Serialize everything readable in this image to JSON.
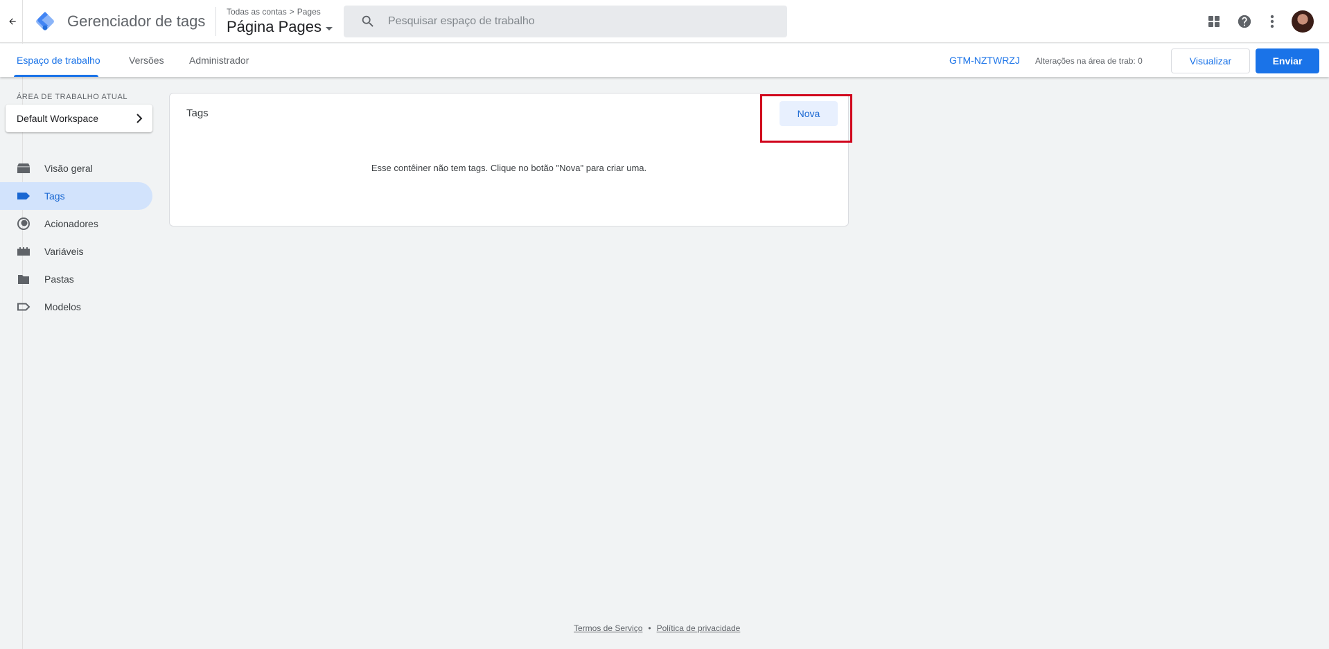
{
  "header": {
    "app_title": "Gerenciador de tags",
    "breadcrumb_account": "Todas as contas",
    "breadcrumb_separator": ">",
    "breadcrumb_container": "Pages",
    "container_name": "Página Pages",
    "search_placeholder": "Pesquisar espaço de trabalho",
    "search_value": "",
    "icons": [
      "back-arrow-icon",
      "gtm-logo",
      "search-icon",
      "apps-grid-icon",
      "help-icon",
      "more-vert-icon",
      "avatar"
    ]
  },
  "nav": {
    "tabs": [
      {
        "label": "Espaço de trabalho",
        "active": true
      },
      {
        "label": "Versões",
        "active": false
      },
      {
        "label": "Administrador",
        "active": false
      }
    ],
    "container_id": "GTM-NZTWRZJ",
    "changes_label": "Alterações na área de trab: 0",
    "preview_label": "Visualizar",
    "submit_label": "Enviar"
  },
  "sidebar": {
    "workspace_caption": "ÁREA DE TRABALHO ATUAL",
    "workspace_name": "Default Workspace",
    "items": [
      {
        "label": "Visão geral",
        "icon": "overview-icon",
        "active": false
      },
      {
        "label": "Tags",
        "icon": "tag-icon",
        "active": true
      },
      {
        "label": "Acionadores",
        "icon": "trigger-icon",
        "active": false
      },
      {
        "label": "Variáveis",
        "icon": "variable-icon",
        "active": false
      },
      {
        "label": "Pastas",
        "icon": "folder-icon",
        "active": false
      },
      {
        "label": "Modelos",
        "icon": "template-icon",
        "active": false
      }
    ]
  },
  "main": {
    "card_title": "Tags",
    "new_button_label": "Nova",
    "empty_message": "Esse contêiner não tem tags. Clique no botão \"Nova\" para criar uma."
  },
  "footer": {
    "terms": "Termos de Serviço",
    "separator": "•",
    "privacy": "Política de privacidade"
  },
  "colors": {
    "accent": "#1a73e8",
    "active_nav_bg": "#d2e3fc",
    "page_bg": "#f1f3f4",
    "highlight": "#d0021b"
  }
}
